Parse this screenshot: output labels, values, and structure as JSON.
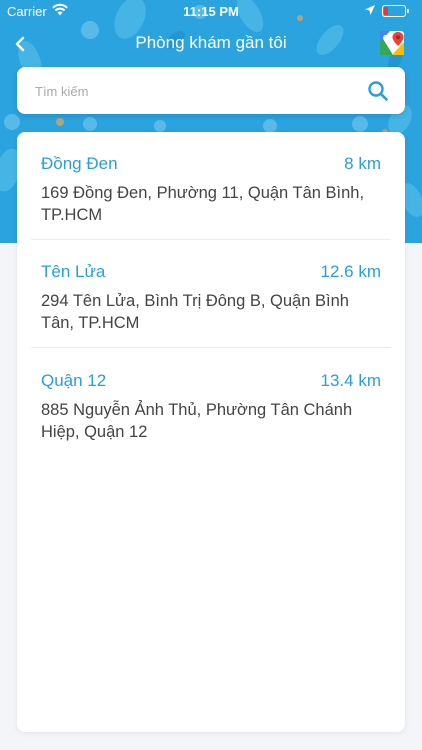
{
  "status_bar": {
    "carrier": "Carrier",
    "time": "11:15 PM"
  },
  "nav": {
    "title": "Phòng khám gần tôi",
    "back_icon": "chevron-left-icon",
    "maps_icon": "google-maps-icon"
  },
  "search": {
    "placeholder": "Tìm kiếm",
    "value": "",
    "icon": "search-icon"
  },
  "clinics": [
    {
      "name": "Đồng Đen",
      "distance": "8 km",
      "address": "169 Đồng Đen, Phường 11, Quận Tân Bình, TP.HCM"
    },
    {
      "name": "Tên Lửa",
      "distance": "12.6 km",
      "address": "294 Tên Lửa, Bình Trị Đông B, Quận Bình Tân, TP.HCM"
    },
    {
      "name": "Quận 12",
      "distance": "13.4 km",
      "address": "885 Nguyễn Ảnh Thủ, Phường Tân Chánh Hiệp, Quận 12"
    }
  ],
  "colors": {
    "header_blue": "#2ba3df",
    "accent": "#2a9fd8",
    "battery_low": "#e53935"
  }
}
